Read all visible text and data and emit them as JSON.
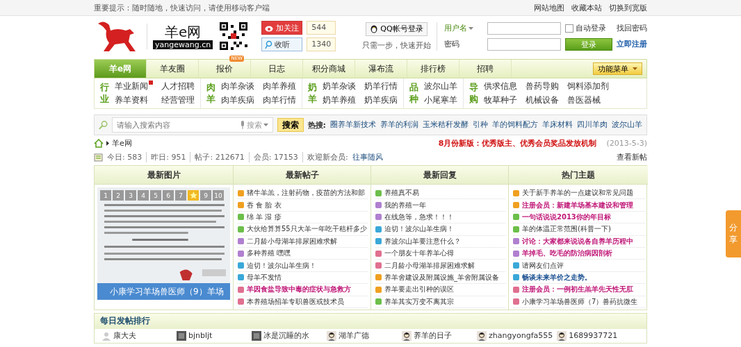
{
  "top_bar": {
    "notice": "重要提示：随时随地，快速访问，请使用移动客户端",
    "links": [
      "网站地图",
      "收藏本站",
      "切换到宽版"
    ]
  },
  "header": {
    "site_name": "羊e网",
    "domain": "yangewang.cn",
    "social": [
      {
        "kind": "weibo",
        "label": "加关注",
        "count": "544"
      },
      {
        "kind": "tencent",
        "label": "收听",
        "count": "1340"
      }
    ],
    "qq_login": {
      "label": "QQ帐号登录",
      "hint": "只需一步，快速开始"
    },
    "login": {
      "user_label": "用户名",
      "password_label": "密码",
      "remember": {
        "label": "自动登录",
        "checked": false
      },
      "submit": "登录",
      "forgot": "找回密码",
      "register": "立即注册"
    }
  },
  "nav": {
    "tabs": [
      {
        "label": "羊e网",
        "selected": true
      },
      {
        "label": "羊友圈",
        "selected": false
      },
      {
        "label": "报价",
        "selected": false,
        "badge": "NEW"
      },
      {
        "label": "日志",
        "selected": false
      },
      {
        "label": "积分商城",
        "selected": false
      },
      {
        "label": "瀑布流",
        "selected": false
      },
      {
        "label": "排行榜",
        "selected": false
      },
      {
        "label": "招聘",
        "selected": false
      }
    ],
    "menu": "功能菜单"
  },
  "categories": [
    {
      "heading": "行业",
      "links": [
        {
          "label": "羊业新闻",
          "new": true
        },
        {
          "label": "人才招聘",
          "new": false
        },
        {
          "label": "养羊资料",
          "new": false
        },
        {
          "label": "经营管理",
          "new": false
        }
      ]
    },
    {
      "heading": "肉羊",
      "links": [
        {
          "label": "肉羊杂谈",
          "new": false
        },
        {
          "label": "肉羊养殖",
          "new": false
        },
        {
          "label": "肉羊疾病",
          "new": false
        },
        {
          "label": "肉羊行情",
          "new": false
        }
      ]
    },
    {
      "heading": "奶羊",
      "links": [
        {
          "label": "奶羊杂谈",
          "new": false
        },
        {
          "label": "奶羊行情",
          "new": false
        },
        {
          "label": "奶羊养殖",
          "new": false
        },
        {
          "label": "奶羊疾病",
          "new": false
        }
      ]
    },
    {
      "heading": "品种",
      "links": [
        {
          "label": "波尔山羊",
          "new": false
        },
        {
          "label": "小尾寒羊",
          "new": false
        }
      ]
    },
    {
      "heading": "导购",
      "links": [
        {
          "label": "供求信息",
          "new": false
        },
        {
          "label": "兽药导购",
          "new": false
        },
        {
          "label": "饲料添加剂",
          "new": false
        },
        {
          "label": "牧草种子",
          "new": false
        },
        {
          "label": "机械设备",
          "new": false
        },
        {
          "label": "兽医器械",
          "new": false
        }
      ]
    }
  ],
  "search": {
    "placeholder": "请输入搜索内容",
    "scope": "搜索",
    "button": "搜索",
    "hot_label": "热搜:",
    "hot": [
      "圈养羊新技术",
      "养羊的利润",
      "玉米秸秆发酵",
      "引种",
      "羊的饲料配方",
      "羊床材料",
      "四川羊肉",
      "波尔山羊"
    ]
  },
  "breadcrumb": "羊e网",
  "announcement": {
    "text": "8月份新版：优秀版主、优秀会员奖品发放机制",
    "date": "(2013-5-3)"
  },
  "stats": [
    {
      "label": "今日:",
      "value": "583"
    },
    {
      "label": "昨日:",
      "value": "951"
    },
    {
      "label": "帖子:",
      "value": "212671"
    },
    {
      "label": "会员:",
      "value": "17153"
    }
  ],
  "welcome": {
    "label": "欢迎新会员:",
    "name": "往事随风"
  },
  "view_new": "查看新帖",
  "gallery": {
    "title": "最新图片",
    "caption": "小康学习羊场兽医师（9）羊场",
    "pager": [
      {
        "kind": "number",
        "label": "1",
        "selected": false
      },
      {
        "kind": "number",
        "label": "2",
        "selected": false
      },
      {
        "kind": "number",
        "label": "3",
        "selected": false
      },
      {
        "kind": "number",
        "label": "4",
        "selected": false
      },
      {
        "kind": "number",
        "label": "5",
        "selected": false
      },
      {
        "kind": "number",
        "label": "6",
        "selected": false
      },
      {
        "kind": "number",
        "label": "7",
        "selected": false
      },
      {
        "kind": "star",
        "selected": true
      },
      {
        "kind": "number",
        "label": "9",
        "selected": false
      },
      {
        "kind": "number",
        "label": "10",
        "selected": false
      }
    ]
  },
  "lists": [
    {
      "title": "最新帖子",
      "posts": [
        {
          "title": "猪牛羊羔，注射药物，疫苗的方法和部",
          "color": "#f0a020",
          "kind": "plain"
        },
        {
          "title": "吞 食 胎 衣",
          "color": "#f0a020",
          "kind": "plain"
        },
        {
          "title": "绵 羊 湿 疹",
          "color": "#6cbf4a",
          "kind": "plain"
        },
        {
          "title": "大伙给算算55只大羊一年吃干秸杆多少",
          "color": "#6cbf4a",
          "kind": "plain"
        },
        {
          "title": "二月龄小母湖羊排尿困难求解",
          "color": "#b080d0",
          "kind": "plain"
        },
        {
          "title": "多种养殖 嘿嘿",
          "color": "#b080d0",
          "kind": "plain"
        },
        {
          "title": "迫切！波尔山羊生病！",
          "color": "#3aa8d8",
          "kind": "plain"
        },
        {
          "title": "母羊不发情",
          "color": "#3aa8d8",
          "kind": "plain"
        },
        {
          "title": "羊因食盐导致中毒的症状与急救方",
          "color": "#e07090",
          "kind": "pink"
        },
        {
          "title": "本养殖场招羊专职兽医或技术员",
          "color": "#e07090",
          "kind": "plain"
        }
      ]
    },
    {
      "title": "最新回复",
      "posts": [
        {
          "title": "养殖真不易",
          "color": "#6cbf4a",
          "kind": "plain"
        },
        {
          "title": "我的养殖一年",
          "color": "#b080d0",
          "kind": "plain"
        },
        {
          "title": "在线急等，急求！！！",
          "color": "#b080d0",
          "kind": "plain"
        },
        {
          "title": "迫切！波尔山羊生病！",
          "color": "#3aa8d8",
          "kind": "plain"
        },
        {
          "title": "养波尔山羊要注意什么？",
          "color": "#3aa8d8",
          "kind": "plain"
        },
        {
          "title": "一个朋友十年养羊心得",
          "color": "#e07090",
          "kind": "plain"
        },
        {
          "title": "二月龄小母湖羊排尿困难求解",
          "color": "#e07090",
          "kind": "plain"
        },
        {
          "title": "养羊舍建设及附属设施_羊舍附属设备",
          "color": "#f0a020",
          "kind": "plain"
        },
        {
          "title": "养羊要走出引种的误区",
          "color": "#f0a020",
          "kind": "plain"
        },
        {
          "title": "养羊其实万变不离其宗",
          "color": "#6cbf4a",
          "kind": "plain"
        }
      ]
    },
    {
      "title": "热门主题",
      "posts": [
        {
          "title": "关于新手养羊的一点建议和常见问题",
          "color": "#f0a020",
          "kind": "plain"
        },
        {
          "title": "注册会员：新建羊场基本建设和管理",
          "color": "#f0a020",
          "kind": "pink"
        },
        {
          "title": "一句话说说2013你的年目标",
          "color": "#6cbf4a",
          "kind": "pink"
        },
        {
          "title": "羊的体温正常范围(科普一下)",
          "color": "#6cbf4a",
          "kind": "plain"
        },
        {
          "title": "讨论：大家都来说说各自养羊历程中",
          "color": "#b080d0",
          "kind": "pink"
        },
        {
          "title": "羊掉毛、吃毛的防治病因剖析",
          "color": "#b080d0",
          "kind": "pink"
        },
        {
          "title": "请网友们点评",
          "color": "#3aa8d8",
          "kind": "plain"
        },
        {
          "title": "畅谈未来羊价之走势。",
          "color": "#3aa8d8",
          "kind": "blue"
        },
        {
          "title": "注册会员：一例初生羔羊先天性无肛",
          "color": "#e07090",
          "kind": "pink"
        },
        {
          "title": "小康学习羊场兽医师（7）兽药抗微生",
          "color": "#e07090",
          "kind": "plain"
        }
      ]
    }
  ],
  "ranking": {
    "title": "每日发帖排行",
    "users": [
      {
        "name": "康大夫",
        "kind": "default"
      },
      {
        "name": "bjnbljt"
      },
      {
        "name": "冰是沉睡的水"
      },
      {
        "name": "湖羊广德",
        "kind": "person"
      },
      {
        "name": "养羊的日子",
        "kind": "person"
      },
      {
        "name": "zhangyongfa555",
        "kind": "person"
      },
      {
        "name": "1689937721",
        "kind": "person"
      }
    ]
  },
  "share": "分享"
}
